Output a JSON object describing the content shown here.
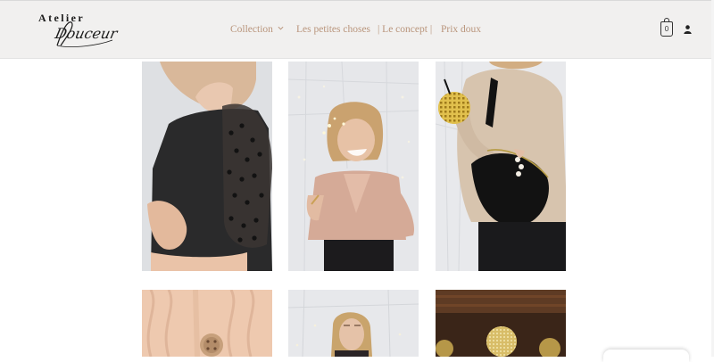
{
  "brand": {
    "line1": "Atelier",
    "line2": "Douceur"
  },
  "nav": {
    "items": [
      {
        "label": "Collection",
        "has_dropdown": true
      },
      {
        "label": "Les petites choses"
      },
      {
        "label": "| Le concept |"
      },
      {
        "label": "Prix doux"
      }
    ],
    "color": "#b9957c"
  },
  "cart": {
    "count": "0",
    "icon": "shopping-bag-icon"
  },
  "account": {
    "icon": "user-icon"
  },
  "gallery": {
    "photos": [
      {
        "name": "black-polka-dot-sleeve-top"
      },
      {
        "name": "pink-wrap-top-with-sparkler"
      },
      {
        "name": "beige-sweater-with-fanny-pack"
      },
      {
        "name": "cream-knit-cardigan-buttons"
      },
      {
        "name": "blonde-woman-with-lights"
      },
      {
        "name": "gold-ornaments-dark"
      }
    ]
  }
}
